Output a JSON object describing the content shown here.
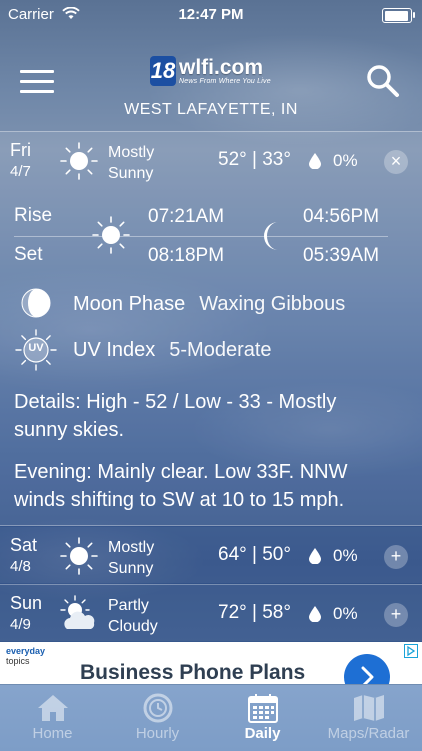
{
  "status_bar": {
    "carrier": "Carrier",
    "time": "12:47 PM"
  },
  "header": {
    "logo_number": "18",
    "logo_name": "wlfi.com",
    "logo_tagline": "News From Where You Live",
    "location": "WEST LAFAYETTE, IN"
  },
  "forecast": [
    {
      "day": "Fri",
      "date": "4/7",
      "icon": "sun-icon",
      "condition_line1": "Mostly",
      "condition_line2": "Sunny",
      "temps": "52° | 33°",
      "precip": "0%",
      "control": "×",
      "expanded": true
    },
    {
      "day": "Sat",
      "date": "4/8",
      "icon": "sun-icon",
      "condition_line1": "Mostly",
      "condition_line2": "Sunny",
      "temps": "64° | 50°",
      "precip": "0%",
      "control": "+"
    },
    {
      "day": "Sun",
      "date": "4/9",
      "icon": "partly-cloudy-icon",
      "condition_line1": "Partly",
      "condition_line2": "Cloudy",
      "temps": "72° | 58°",
      "precip": "0%",
      "control": "+"
    }
  ],
  "detail": {
    "rise_label": "Rise",
    "set_label": "Set",
    "sunrise": "07:21AM",
    "sunset": "08:18PM",
    "moonrise": "04:56PM",
    "moonset": "05:39AM",
    "moon_phase_label": "Moon Phase",
    "moon_phase_value": "Waxing Gibbous",
    "uv_icon_text": "UV",
    "uv_label": "UV Index",
    "uv_value": "5-Moderate",
    "details_text": "Details: High - 52 / Low - 33 - Mostly sunny skies.",
    "evening_text": "Evening: Mainly clear. Low 33F. NNW winds shifting to SW at 10 to 15 mph."
  },
  "ad": {
    "brand_line1": "everyday",
    "brand_line2": "topics",
    "headline": "Business Phone Plans"
  },
  "tabs": [
    {
      "label": "Home",
      "icon": "home-icon"
    },
    {
      "label": "Hourly",
      "icon": "clock-icon"
    },
    {
      "label": "Daily",
      "icon": "calendar-icon",
      "active": true
    },
    {
      "label": "Maps/Radar",
      "icon": "map-icon"
    }
  ],
  "colors": {
    "accent_tab": "#ffffff",
    "tabbar": "#7d9dc7",
    "ad_button": "#1e6fd4"
  }
}
